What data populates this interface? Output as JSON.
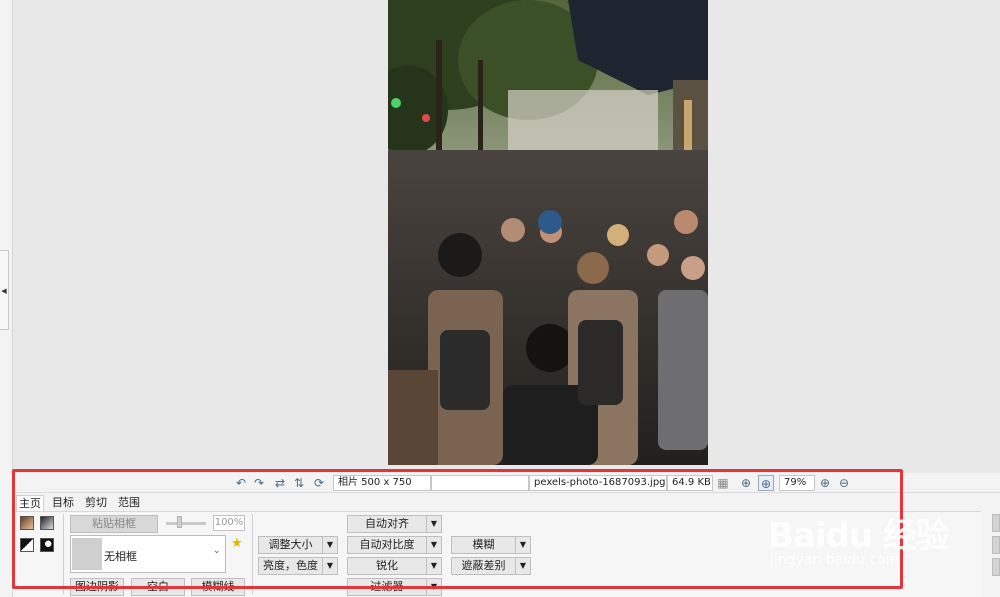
{
  "info_bar": {
    "undo_icon": "undo-icon",
    "redo_icon": "redo-icon",
    "flip_h_icon": "flip-horizontal-icon",
    "flip_v_icon": "flip-vertical-icon",
    "rotate_icon": "rotate-icon",
    "dimensions": "相片 500 x 750",
    "blank_field": "",
    "filename": "pexels-photo-1687093.jpg",
    "filesize": "64.9 KB",
    "zoom": "79%"
  },
  "tabs": [
    {
      "label": "主页",
      "active": true
    },
    {
      "label": "目标",
      "active": false
    },
    {
      "label": "剪切",
      "active": false
    },
    {
      "label": "范围",
      "active": false
    }
  ],
  "panel": {
    "paste_frame": "粘贴相框",
    "opacity_value": "100%",
    "frame_select": "无相框",
    "bottom_row": [
      "图边阴影",
      "空白",
      "模糊线"
    ],
    "resize": "调整大小",
    "brightness": "亮度，色度",
    "auto_align": "自动对齐",
    "auto_contrast": "自动对比度",
    "sharpen": "锐化",
    "filter": "过滤器",
    "blur": "模糊",
    "mask_diff": "遮蔽差别"
  },
  "watermark": {
    "brand": "Baidu 经验",
    "url": "jingyan.baidu.com"
  },
  "colors": {
    "highlight_border": "#e4363a",
    "toolbar_bg": "#f3f3f3",
    "canvas_bg": "#e8e8e8"
  }
}
